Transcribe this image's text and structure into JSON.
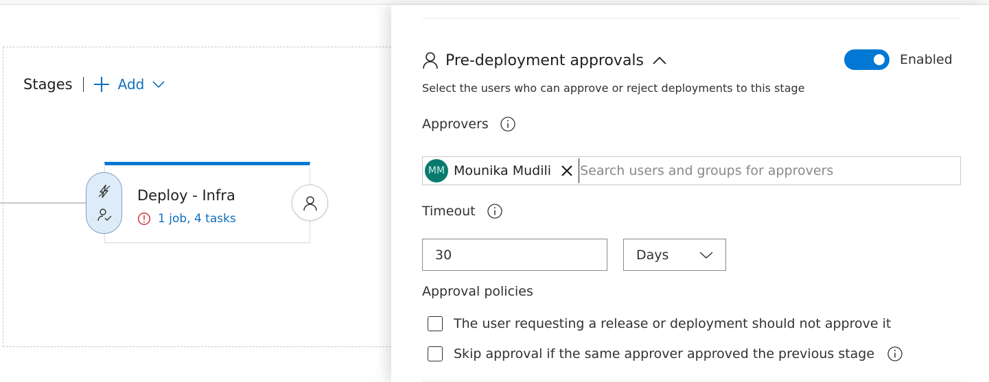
{
  "stages": {
    "title": "Stages",
    "add_label": "Add",
    "stage": {
      "name": "Deploy - Infra",
      "tasks": "1 job, 4 tasks"
    }
  },
  "panel": {
    "section_title": "Pre-deployment approvals",
    "toggle_label": "Enabled",
    "toggle_on": true,
    "description": "Select the users who can approve or reject deployments to this stage",
    "approvers": {
      "label": "Approvers",
      "selected": [
        {
          "initials": "MM",
          "name": "Mounika Mudili"
        }
      ],
      "search_placeholder": "Search users and groups for approvers"
    },
    "timeout": {
      "label": "Timeout",
      "value": "30",
      "unit": "Days"
    },
    "policies": {
      "label": "Approval policies",
      "items": [
        {
          "label": "The user requesting a release or deployment should not approve it",
          "checked": false
        },
        {
          "label": "Skip approval if the same approver approved the previous stage",
          "checked": false
        }
      ]
    }
  },
  "colors": {
    "accent": "#0078d4",
    "link": "#106ebe",
    "error": "#a4262c",
    "avatar": "#0b7a6e"
  }
}
